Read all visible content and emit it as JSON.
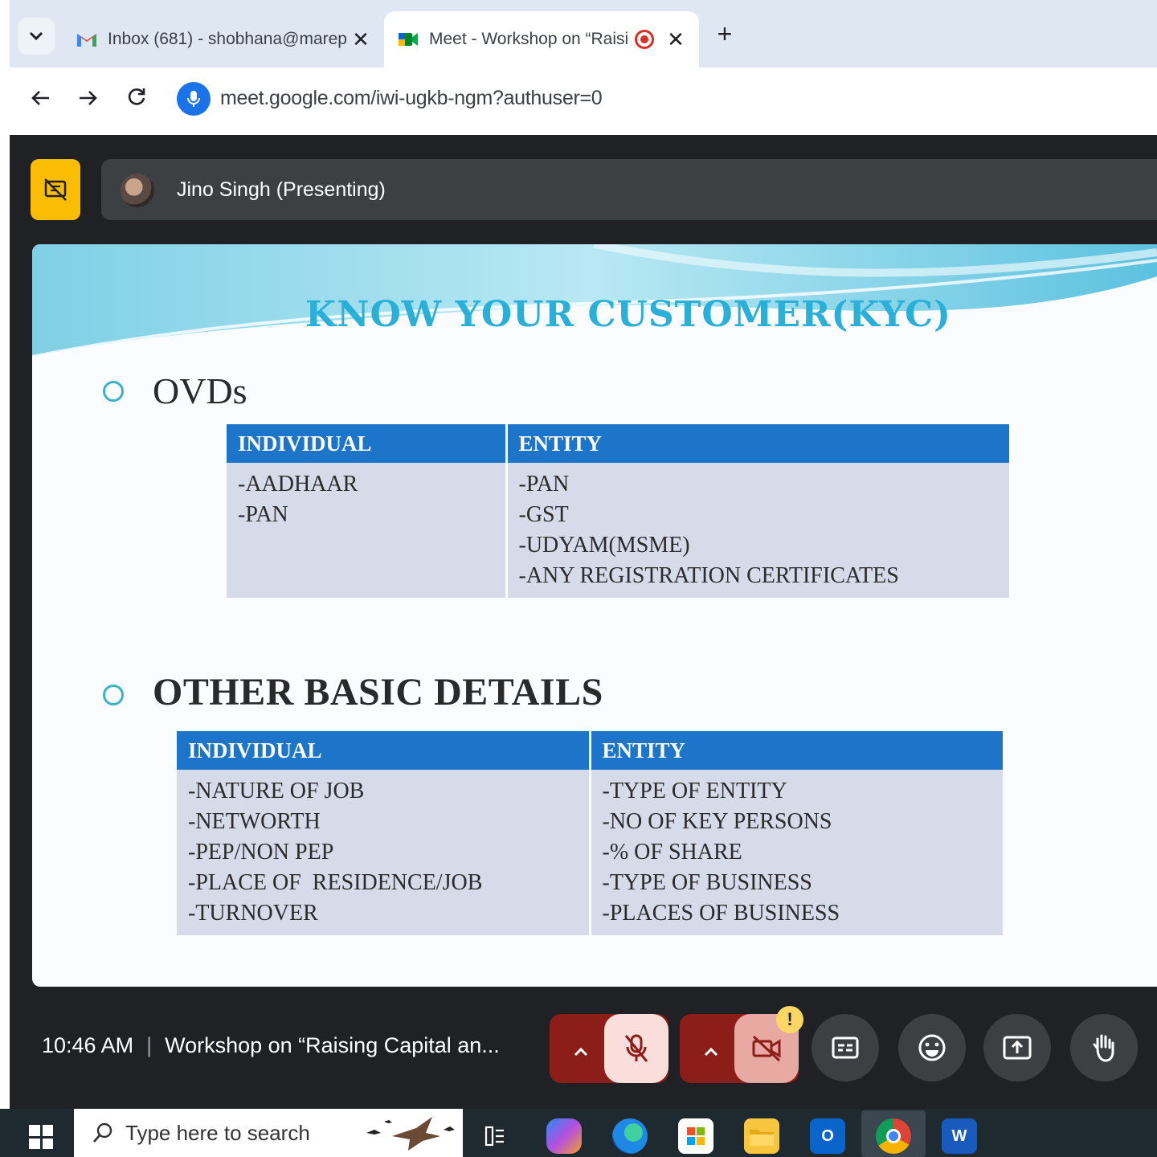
{
  "browser": {
    "tabs": [
      {
        "title": "Inbox (681) - shobhana@marep",
        "icon": "gmail-icon",
        "active": false
      },
      {
        "title": "Meet - Workshop on “Raisin",
        "icon": "google-meet-icon",
        "active": true,
        "recording": true
      }
    ],
    "new_tab_label": "+",
    "close_label": "✕",
    "url": "meet.google.com/iwi-ugkb-ngm?authuser=0"
  },
  "meet": {
    "presenter_label": "Jino Singh (Presenting)",
    "time": "10:46 AM",
    "separator": "|",
    "meeting_title": "Workshop on “Raising Capital an...",
    "mic_state": "muted",
    "camera_state": "off",
    "camera_warning": "!",
    "accent_color": "#fbbc04",
    "danger_color": "#8c1d18"
  },
  "slide": {
    "title": "KNOW YOUR CUSTOMER(KYC)",
    "sections": [
      {
        "heading": "OVDs",
        "columns": [
          "INDIVIDUAL",
          "ENTITY"
        ],
        "individual": [
          "-AADHAAR",
          "-PAN"
        ],
        "entity": [
          "-PAN",
          "-GST",
          "-UDYAM(MSME)",
          "-ANY REGISTRATION CERTIFICATES"
        ]
      },
      {
        "heading": "OTHER BASIC DETAILS",
        "columns": [
          "INDIVIDUAL",
          "ENTITY"
        ],
        "individual": [
          "-NATURE OF JOB",
          "-NETWORTH",
          "-PEP/NON PEP",
          "-PLACE OF  RESIDENCE/JOB",
          "-TURNOVER"
        ],
        "entity": [
          "-TYPE OF ENTITY",
          "-NO OF KEY PERSONS",
          "-% OF SHARE",
          "-TYPE OF BUSINESS",
          "-PLACES OF BUSINESS"
        ]
      }
    ],
    "header_color": "#1c75c9",
    "cell_color": "#d6dbea"
  },
  "taskbar": {
    "search_placeholder": "Type here to search",
    "apps": [
      "task-view-icon",
      "copilot-icon",
      "edge-icon",
      "store-icon",
      "file-explorer-icon",
      "outlook-icon",
      "chrome-icon",
      "word-icon"
    ]
  }
}
